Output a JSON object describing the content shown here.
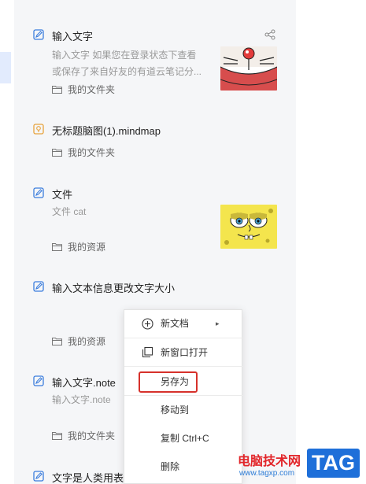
{
  "notes": [
    {
      "title": "输入文字",
      "preview_line1": "输入文字 如果您在登录状态下查看",
      "preview_line2": "或保存了来自好友的有道云笔记分...",
      "folder": "我的文件夹",
      "icon": "note-icon"
    },
    {
      "title": "无标题脑图(1).mindmap",
      "folder": "我的文件夹",
      "icon": "mindmap-icon"
    },
    {
      "title": "文件",
      "preview_line1": "文件 cat",
      "folder": "我的资源",
      "icon": "note-icon"
    },
    {
      "title": "输入文本信息更改文字大小",
      "folder": "我的资源",
      "icon": "note-icon"
    },
    {
      "title": "输入文字.note",
      "preview_line1": "输入文字.note",
      "folder": "我的文件夹",
      "icon": "note-icon"
    },
    {
      "title": "文字是人类用表达",
      "icon": "note-icon"
    }
  ],
  "context_menu": {
    "new_doc": "新文档",
    "open_new_window": "新窗口打开",
    "save_as": "另存为",
    "move_to": "移动到",
    "copy": "复制 Ctrl+C",
    "delete": "删除"
  },
  "watermark": {
    "title": "电脑技术网",
    "url": "www.tagxp.com",
    "tag": "TAG"
  },
  "colors": {
    "accent": "#3b7ddd",
    "highlight_border": "#d6312b",
    "list_background": "#f5f6f8",
    "mindmap_icon": "#e8a33d"
  }
}
